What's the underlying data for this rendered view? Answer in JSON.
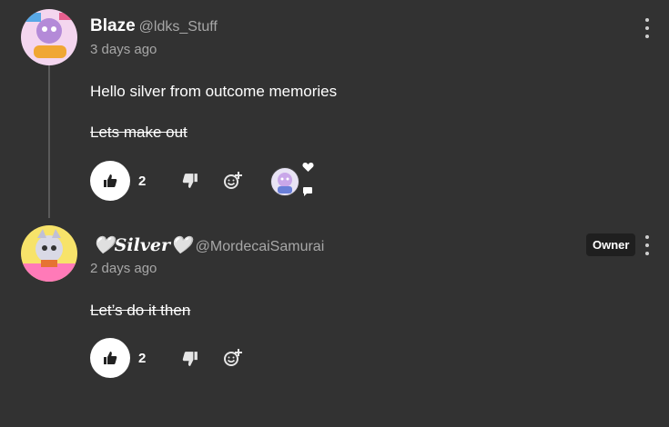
{
  "comments": [
    {
      "author": "Blaze",
      "handle": "@ldks_Stuff",
      "time": "3 days ago",
      "lines": [
        "Hello silver from outcome memories"
      ],
      "struck_lines": [
        "Lets make out"
      ],
      "likes": "2",
      "avatar_icon": "blaze-avatar"
    },
    {
      "author": "🤍𝑺𝒊𝒍𝒗𝒆𝒓🤍",
      "handle": "@MordecaiSamurai",
      "time": "2 days ago",
      "struck_lines": [
        "Let’s do it then"
      ],
      "likes": "2",
      "badge": "Owner",
      "avatar_icon": "silver-avatar"
    }
  ],
  "colors": {
    "background": "#323232",
    "muted_text": "#a7a7a7",
    "like_button": "#ffffff"
  }
}
